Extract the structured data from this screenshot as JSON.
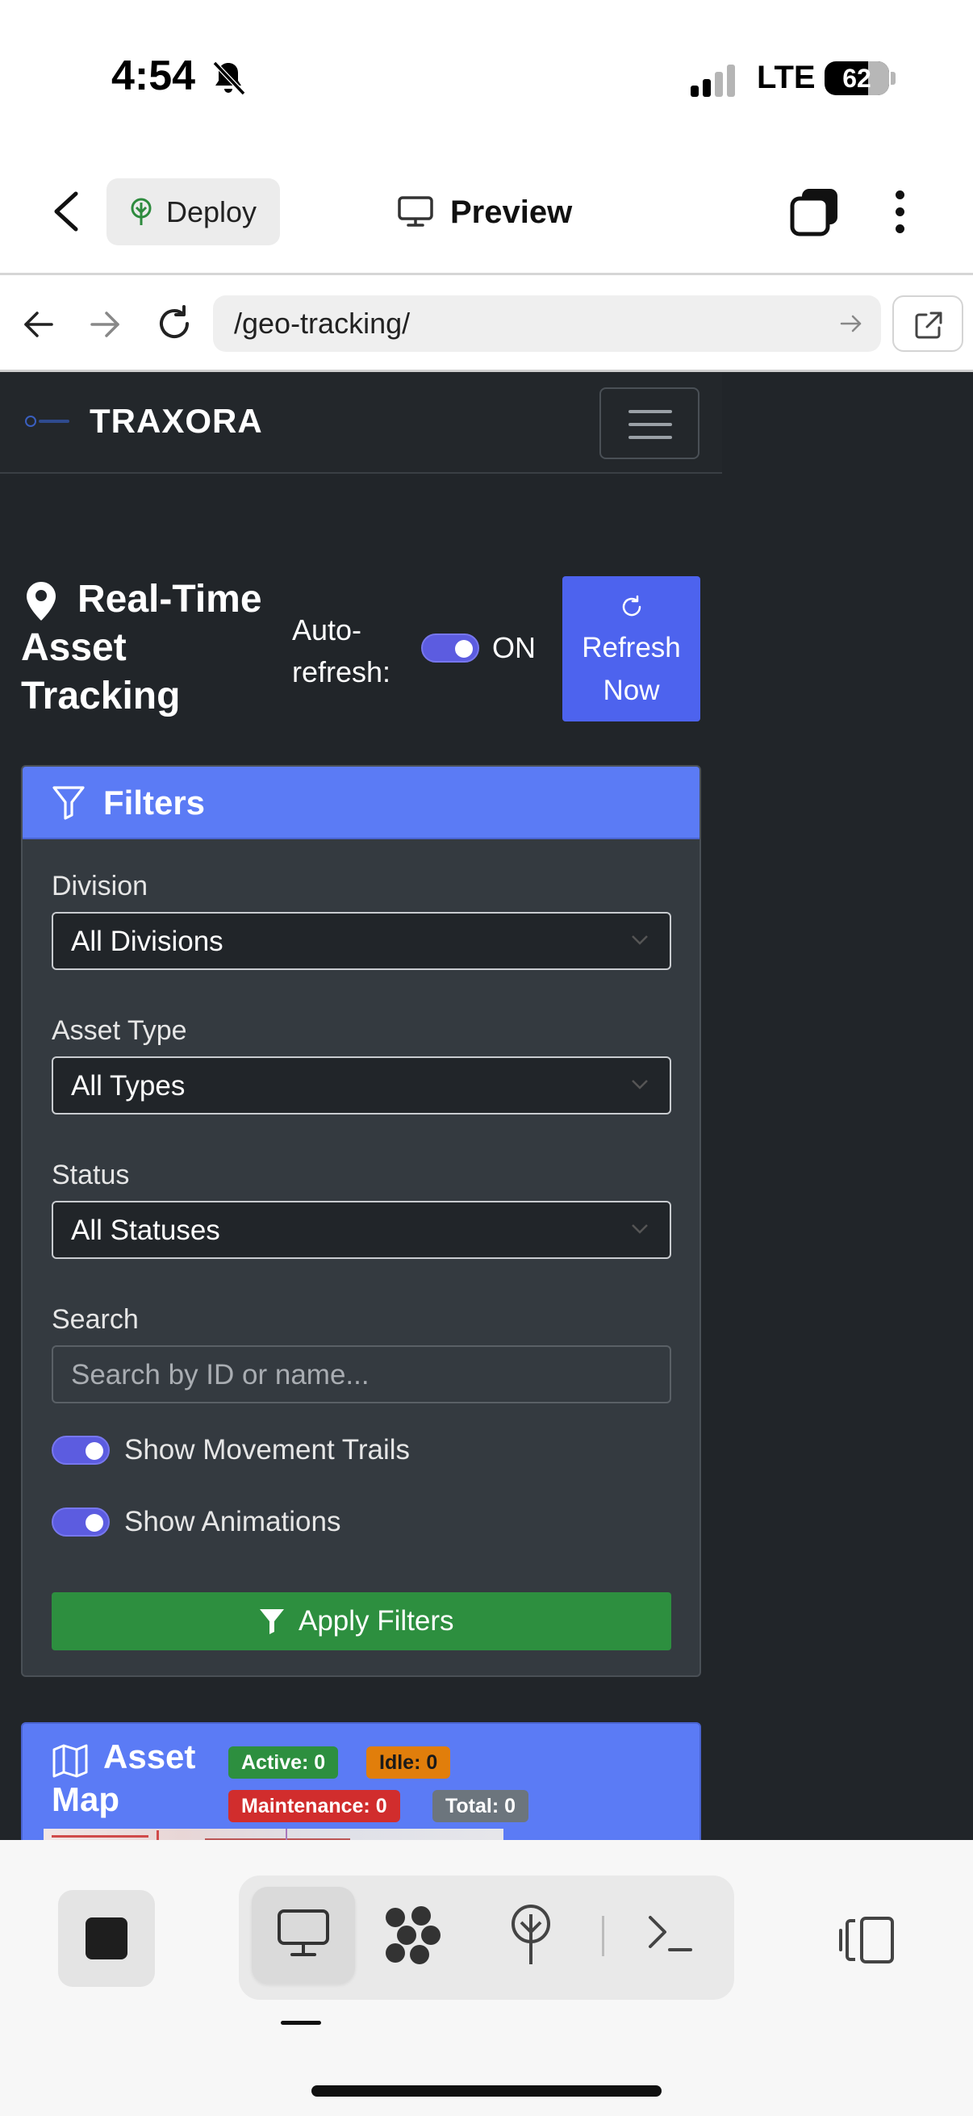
{
  "status_bar": {
    "time": "4:54",
    "network": "LTE",
    "battery": "62"
  },
  "app_header": {
    "deploy_label": "Deploy",
    "preview_label": "Preview"
  },
  "address_bar": {
    "url": "/geo-tracking/"
  },
  "site": {
    "brand": "TRAXORA",
    "page_title": "Real-Time Asset Tracking",
    "auto_refresh_label": "Auto-refresh:",
    "auto_refresh_state": "ON",
    "refresh_button": "Refresh Now"
  },
  "filters": {
    "title": "Filters",
    "division_label": "Division",
    "division_value": "All Divisions",
    "asset_type_label": "Asset Type",
    "asset_type_value": "All Types",
    "status_label": "Status",
    "status_value": "All Statuses",
    "search_label": "Search",
    "search_placeholder": "Search by ID or name...",
    "show_trails_label": "Show Movement Trails",
    "show_animations_label": "Show Animations",
    "apply_button": "Apply Filters"
  },
  "asset_map": {
    "title": "Asset Map",
    "badges": {
      "active": "Active: 0",
      "idle": "Idle: 0",
      "maintenance": "Maintenance: 0",
      "total": "Total: 0"
    }
  },
  "colors": {
    "accent_blue": "#5b7bf5",
    "refresh_blue": "#4d63ee",
    "success_green": "#2d8f3f",
    "warning_orange": "#e17e0b",
    "danger_red": "#d12d2d",
    "toggle_purple": "#5c5ce0",
    "page_dark": "#212529"
  }
}
